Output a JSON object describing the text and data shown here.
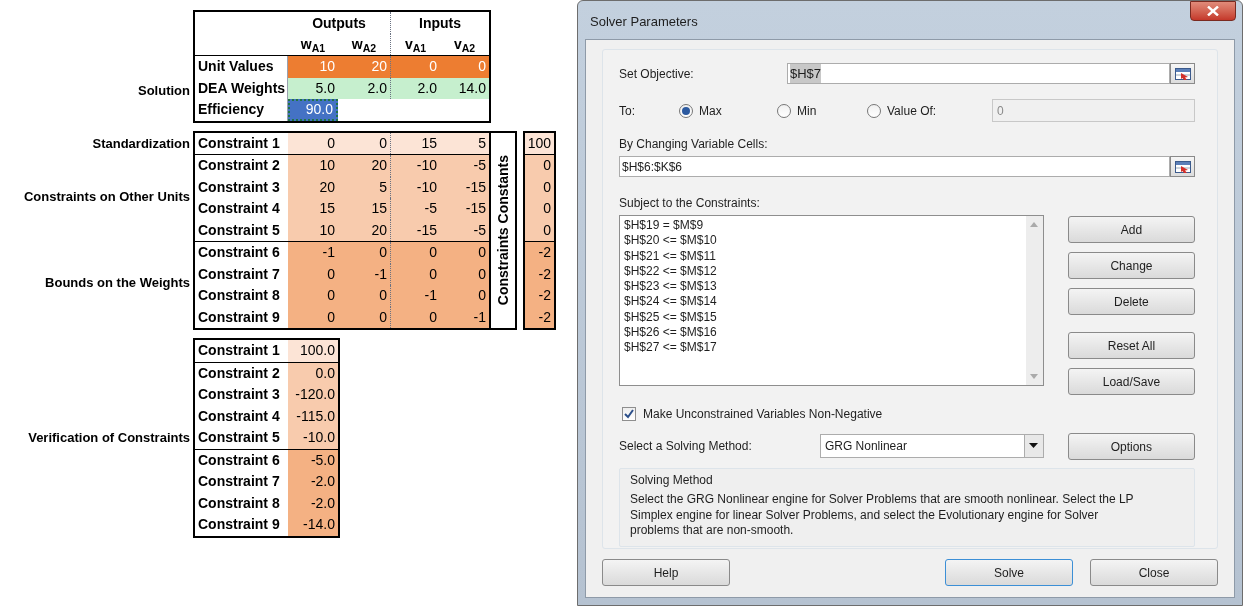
{
  "spreadsheet": {
    "header": {
      "groups": [
        "Outputs",
        "Inputs"
      ],
      "variables": [
        "w$_{A1}$",
        "w$_{A2}$",
        "v$_{A1}$",
        "v$_{A2}$"
      ]
    },
    "solution": {
      "label": "Solution",
      "rows": [
        {
          "kind": "unit_values",
          "label": "Unit Values",
          "values": [
            "10",
            "20",
            "0",
            "0"
          ]
        },
        {
          "kind": "weights",
          "label": "DEA Weights",
          "values": [
            "5.0",
            "2.0",
            "2.0",
            "14.0"
          ]
        },
        {
          "kind": "efficiency",
          "label": "Efficiency",
          "values": [
            "90.0"
          ],
          "selected": true
        }
      ]
    },
    "constraints": {
      "constants_label": "Constraints Constants",
      "groups": [
        {
          "kind": "standardization",
          "label": "Standardization",
          "rows": [
            {
              "label": "Constraint 1",
              "values": [
                "0",
                "0",
                "15",
                "5"
              ],
              "constant": "100"
            }
          ]
        },
        {
          "kind": "other_units",
          "label": "Constraints on Other Units",
          "rows": [
            {
              "label": "Constraint 2",
              "values": [
                "10",
                "20",
                "-10",
                "-5"
              ],
              "constant": "0"
            },
            {
              "label": "Constraint 3",
              "values": [
                "20",
                "5",
                "-10",
                "-15"
              ],
              "constant": "0"
            },
            {
              "label": "Constraint 4",
              "values": [
                "15",
                "15",
                "-5",
                "-15"
              ],
              "constant": "0"
            },
            {
              "label": "Constraint 5",
              "values": [
                "10",
                "20",
                "-15",
                "-5"
              ],
              "constant": "0"
            }
          ]
        },
        {
          "kind": "bounds",
          "label": "Bounds on the Weights",
          "rows": [
            {
              "label": "Constraint 6",
              "values": [
                "-1",
                "0",
                "0",
                "0"
              ],
              "constant": "-2"
            },
            {
              "label": "Constraint 7",
              "values": [
                "0",
                "-1",
                "0",
                "0"
              ],
              "constant": "-2"
            },
            {
              "label": "Constraint 8",
              "values": [
                "0",
                "0",
                "-1",
                "0"
              ],
              "constant": "-2"
            },
            {
              "label": "Constraint 9",
              "values": [
                "0",
                "0",
                "0",
                "-1"
              ],
              "constant": "-2"
            }
          ]
        }
      ]
    },
    "verification": {
      "label": "Verification of Constraints",
      "groups": [
        {
          "kind": "standardization",
          "rows": [
            {
              "label": "Constraint 1",
              "value": "100.0"
            }
          ]
        },
        {
          "kind": "other_units",
          "rows": [
            {
              "label": "Constraint 2",
              "value": "0.0"
            },
            {
              "label": "Constraint 3",
              "value": "-120.0"
            },
            {
              "label": "Constraint 4",
              "value": "-115.0"
            },
            {
              "label": "Constraint 5",
              "value": "-10.0"
            }
          ]
        },
        {
          "kind": "bounds",
          "rows": [
            {
              "label": "Constraint 6",
              "value": "-5.0"
            },
            {
              "label": "Constraint 7",
              "value": "-2.0"
            },
            {
              "label": "Constraint 8",
              "value": "-2.0"
            },
            {
              "label": "Constraint 9",
              "value": "-14.0"
            }
          ]
        }
      ]
    }
  },
  "dialog": {
    "title": "Solver Parameters",
    "objective": {
      "label": "Set Objective:",
      "value": "$H$7"
    },
    "to": {
      "label": "To:",
      "options": [
        {
          "label": "Max",
          "selected": true
        },
        {
          "label": "Min",
          "selected": false
        },
        {
          "label": "Value Of:",
          "selected": false
        }
      ],
      "value_of": {
        "value": "0",
        "disabled": true
      }
    },
    "changing_cells": {
      "label": "By Changing Variable Cells:",
      "value": "$H$6:$K$6"
    },
    "constraints": {
      "label": "Subject to the Constraints:",
      "items": [
        "$H$19 = $M$9",
        "$H$20 <= $M$10",
        "$H$21 <= $M$11",
        "$H$22 <= $M$12",
        "$H$23 <= $M$13",
        "$H$24 <= $M$14",
        "$H$25 <= $M$15",
        "$H$26 <= $M$16",
        "$H$27 <= $M$17"
      ]
    },
    "side_buttons": [
      "Add",
      "Change",
      "Delete",
      "Reset All",
      "Load/Save"
    ],
    "non_negative": {
      "label": "Make Unconstrained Variables Non-Negative",
      "checked": true
    },
    "method": {
      "label": "Select a Solving Method:",
      "value": "GRG Nonlinear"
    },
    "options_button": "Options",
    "description": {
      "title": "Solving Method",
      "text": "Select the GRG Nonlinear engine for Solver Problems that are smooth nonlinear. Select the LP Simplex engine for linear Solver Problems, and select the Evolutionary engine for Solver problems that are non-smooth."
    },
    "footer_buttons": [
      {
        "label": "Help",
        "default": false
      },
      {
        "label": "Solve",
        "default": true
      },
      {
        "label": "Close",
        "default": false
      }
    ]
  }
}
